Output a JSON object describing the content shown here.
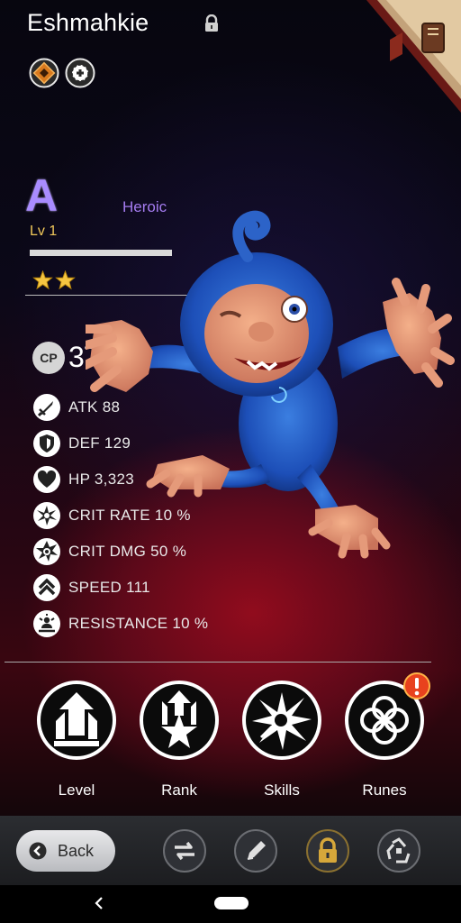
{
  "monster": {
    "name": "Eshmahkie",
    "grade": "A",
    "rarity": "Heroic",
    "level": "Lv 1",
    "xp_fraction": 1.0,
    "stars": 2,
    "cp_label": "CP",
    "cp_value": "376"
  },
  "stats": [
    {
      "icon": "sword-icon",
      "label": "ATK 88"
    },
    {
      "icon": "shield-icon",
      "label": "DEF 129"
    },
    {
      "icon": "heart-icon",
      "label": "HP 3,323"
    },
    {
      "icon": "crit-rate-icon",
      "label": "CRIT RATE 10 %"
    },
    {
      "icon": "crit-dmg-icon",
      "label": "CRIT DMG 50 %"
    },
    {
      "icon": "speed-icon",
      "label": "SPEED 111"
    },
    {
      "icon": "resistance-icon",
      "label": "RESISTANCE 10 %"
    }
  ],
  "actions": [
    {
      "label": "Level",
      "icon": "level-up-icon"
    },
    {
      "label": "Rank",
      "icon": "rank-star-icon"
    },
    {
      "label": "Skills",
      "icon": "skills-burst-icon"
    },
    {
      "label": "Runes",
      "icon": "runes-rings-icon",
      "alert": true
    }
  ],
  "bottom_bar": {
    "back_label": "Back",
    "buttons": [
      "swap-icon",
      "rename-pencil-icon",
      "lock-icon",
      "recycle-icon"
    ]
  },
  "colors": {
    "grade": "#a98cff",
    "rarity": "#a57cf0",
    "level": "#f0c75a",
    "star": "#f5c542",
    "alert": "#e8421e"
  }
}
